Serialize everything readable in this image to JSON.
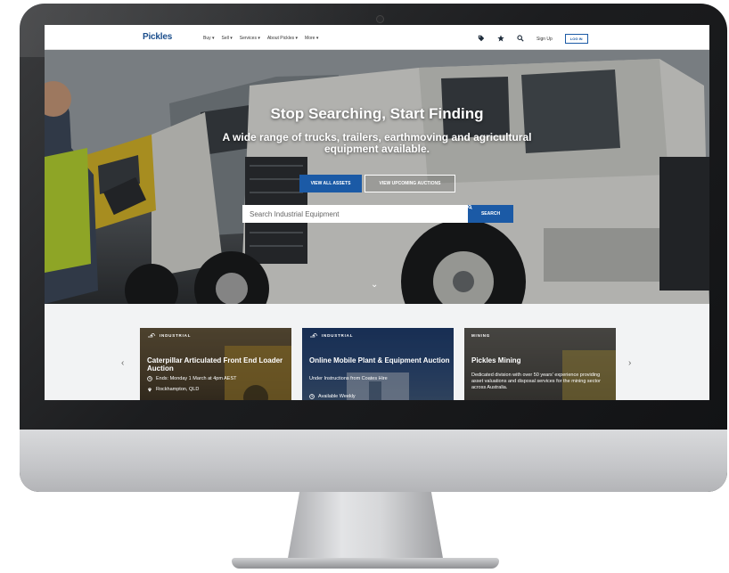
{
  "brand": {
    "logo": "Pickles",
    "accent": "#1b5aa6"
  },
  "nav": {
    "menu": [
      "Buy ▾",
      "Sell ▾",
      "Services ▾",
      "About Pickles ▾",
      "More ▾"
    ],
    "icons": [
      "tag-icon",
      "star-icon",
      "search-icon"
    ],
    "signup": "Sign Up",
    "login": "LOG IN"
  },
  "hero": {
    "title": "Stop Searching, Start Finding",
    "subtitle": "A wide range of trucks, trailers, earthmoving and agricultural equipment available.",
    "btn_assets": "VIEW ALL ASSETS",
    "btn_auctions": "VIEW UPCOMING AUCTIONS",
    "search_placeholder": "Search Industrial Equipment",
    "search_button": "SEARCH"
  },
  "cards": [
    {
      "category": "INDUSTRIAL",
      "title": "Caterpillar Articulated Front End Loader Auction",
      "ends": "Ends: Monday 1 March at 4pm AEST",
      "location": "Rockhampton, QLD"
    },
    {
      "category": "INDUSTRIAL",
      "title": "Online Mobile Plant & Equipment Auction",
      "note": "Under Instructions from Coates Hire",
      "extra": "Available Weekly"
    },
    {
      "category": "MINING",
      "title": "Pickles Mining",
      "description": "Dedicated division with over 50 years' experience providing asset valuations and disposal services for the mining sector across Australia."
    }
  ],
  "arrows": {
    "prev": "‹",
    "next": "›"
  },
  "scroll_hint": "⌄"
}
